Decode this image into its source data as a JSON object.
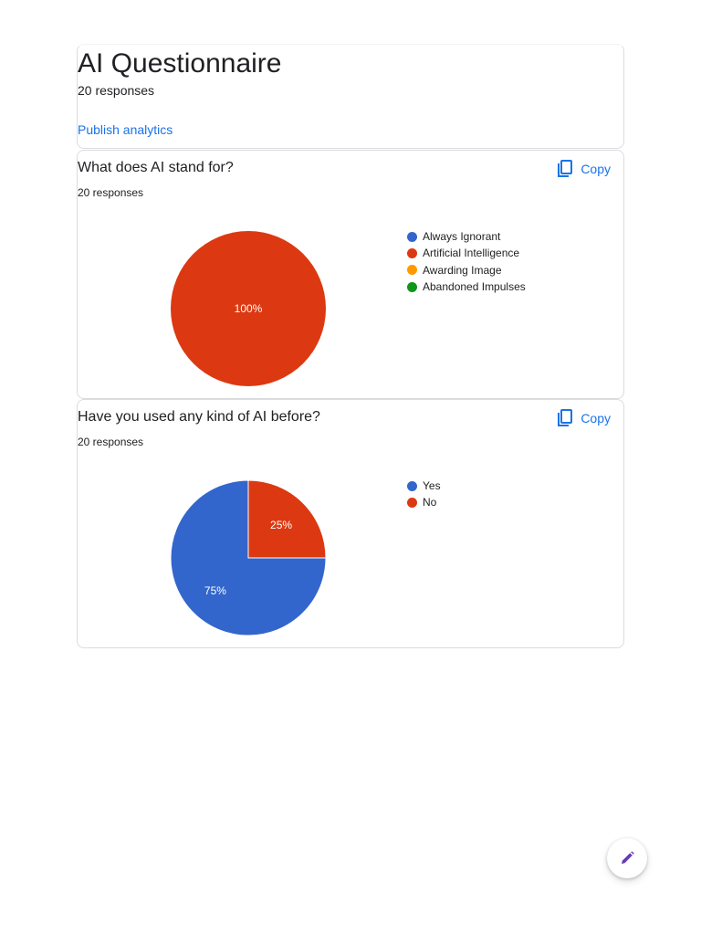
{
  "header": {
    "title": "AI Questionnaire",
    "responses": "20 responses",
    "publish_link": "Publish analytics"
  },
  "colors": {
    "accent": "#1a73e8",
    "edit_icon": "#673ab7",
    "series_blue": "#3366cc",
    "series_red": "#dc3912",
    "series_orange": "#ff9900",
    "series_green": "#109618"
  },
  "questions": [
    {
      "title": "What does AI stand for?",
      "responses": "20 responses",
      "copy_label": "Copy",
      "copy_icon": "copy-icon"
    },
    {
      "title": "Have you used any kind of AI before?",
      "responses": "20 responses",
      "copy_label": "Copy",
      "copy_icon": "copy-icon"
    }
  ],
  "fab": {
    "icon": "pencil-icon"
  },
  "chart_data": [
    {
      "type": "pie",
      "categories": [
        "Always Ignorant",
        "Artificial Intelligence",
        "Awarding Image",
        "Abandoned Impulses"
      ],
      "values": [
        0,
        100,
        0,
        0
      ],
      "labels": [
        "",
        "100%",
        "",
        ""
      ],
      "colors": [
        "#3366cc",
        "#dc3912",
        "#ff9900",
        "#109618"
      ],
      "legend": "right"
    },
    {
      "type": "pie",
      "categories": [
        "Yes",
        "No"
      ],
      "values": [
        75,
        25
      ],
      "labels": [
        "75%",
        "25%"
      ],
      "colors": [
        "#3366cc",
        "#dc3912"
      ],
      "legend": "right"
    }
  ]
}
